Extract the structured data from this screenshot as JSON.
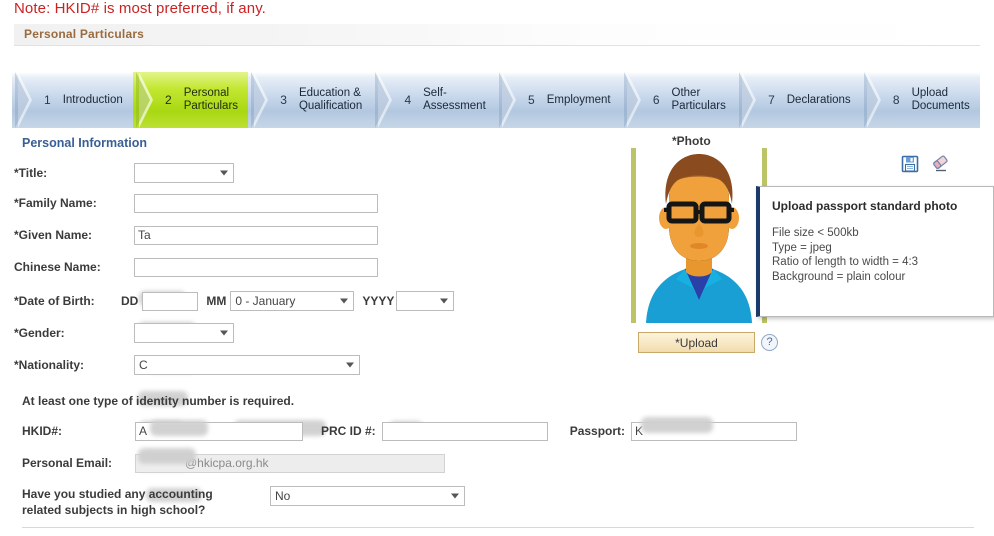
{
  "note": {
    "text": "Note: HKID# is most preferred, if any."
  },
  "section": {
    "title": "Personal Particulars"
  },
  "wizard": {
    "steps": [
      {
        "num": "1",
        "label": "Introduction",
        "active": false
      },
      {
        "num": "2",
        "label": "Personal\nParticulars",
        "active": true
      },
      {
        "num": "3",
        "label": "Education &\nQualification",
        "active": false
      },
      {
        "num": "4",
        "label": "Self-\nAssessment",
        "active": false
      },
      {
        "num": "5",
        "label": "Employment",
        "active": false
      },
      {
        "num": "6",
        "label": "Other\nParticulars",
        "active": false
      },
      {
        "num": "7",
        "label": "Declarations",
        "active": false
      },
      {
        "num": "8",
        "label": "Upload\nDocuments",
        "active": false
      }
    ]
  },
  "form": {
    "heading": "Personal Information",
    "title_label": "*Title:",
    "title_value": "",
    "family_name_label": "*Family Name:",
    "family_name_value": "",
    "given_name_label": "*Given Name:",
    "given_name_value": "Ta",
    "chinese_name_label": "Chinese Name:",
    "chinese_name_value": "",
    "dob_label": "*Date of Birth:",
    "dob_dd_prefix": "DD",
    "dob_dd_value": "",
    "dob_mm_prefix": "MM",
    "dob_mm_value": "0  - January",
    "dob_yyyy_prefix": "YYYY",
    "dob_yyyy_value": "",
    "gender_label": "*Gender:",
    "gender_value": "",
    "nationality_label": "*Nationality:",
    "nationality_value": "C",
    "identity_note": "At least one type of identity number is required.",
    "hkid_label": "HKID#:",
    "hkid_value": "A",
    "prc_label": "PRC ID #:",
    "prc_value": "",
    "passport_label": "Passport:",
    "passport_value": "K",
    "email_label": "Personal Email:",
    "email_value": "@hkicpa.org.hk",
    "question_label": "Have you studied any accounting related subjects in high school?",
    "question_value": "No"
  },
  "photo": {
    "label": "*Photo",
    "upload_button": "*Upload",
    "help_icon": "?",
    "save_icon": "save-floppy-icon",
    "erase_icon": "eraser-icon"
  },
  "tooltip": {
    "title": "Upload passport standard photo",
    "lines": [
      "File size < 500kb",
      "Type = jpeg",
      "Ratio of length to width = 4:3",
      "Background = plain colour"
    ]
  },
  "colors": {
    "note_red": "#cc2222",
    "section_title": "#9a6b3f",
    "panel_heading": "#3a5f94",
    "active_step": "#a9d812",
    "step_bg": "#c4d5ea",
    "photo_border": "#bcc468",
    "tooltip_accent": "#1b3a6b",
    "upload_button": "#f2dcae"
  }
}
